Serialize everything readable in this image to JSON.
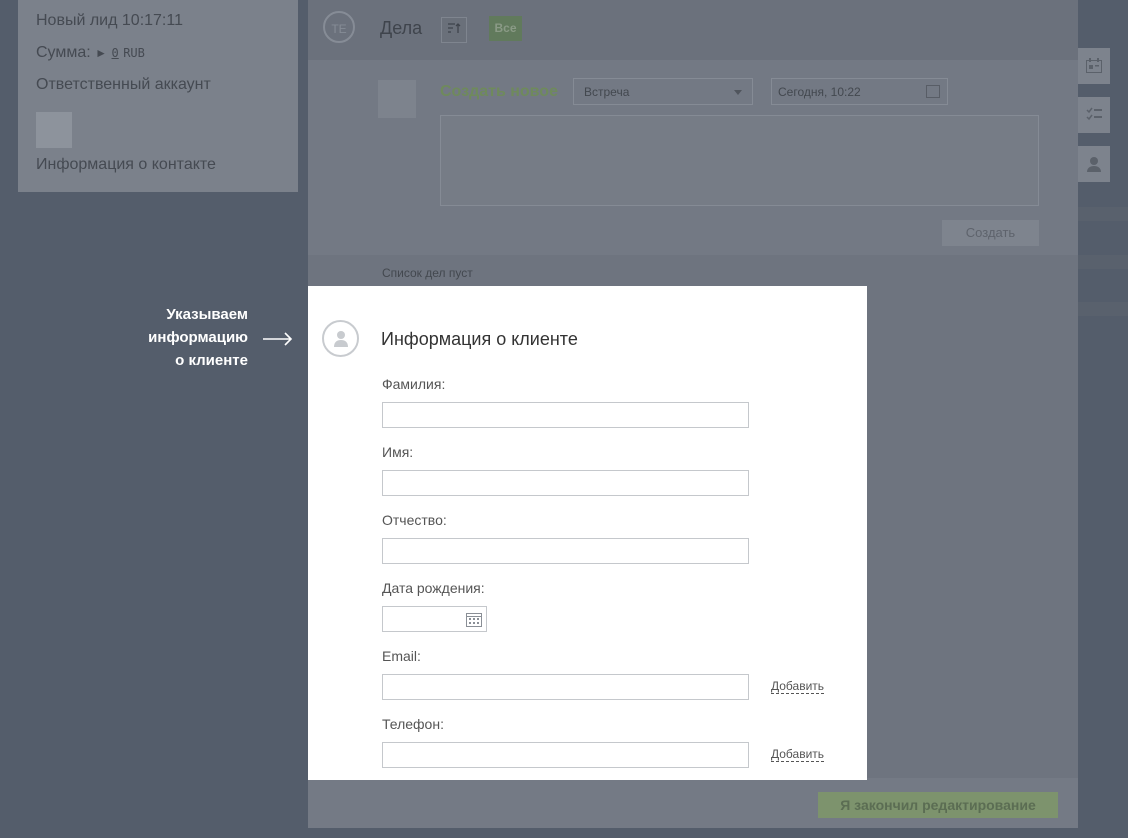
{
  "lead_card": {
    "title": "Новый лид 10:17:11",
    "sum_label": "Сумма:",
    "sum_value": "0",
    "currency": "RUB",
    "responsible": "Ответственный аккаунт",
    "contact_info": "Информация о контакте"
  },
  "deals": {
    "icon_text": "TE",
    "title": "Дела",
    "filter_all": "Все",
    "create_new": "Создать новое",
    "type_value": "Встреча",
    "date_value": "Сегодня, 10:22",
    "create_button": "Создать",
    "empty_list": "Список дел пуст"
  },
  "annotation": {
    "line1": "Указываем",
    "line2": "информацию",
    "line3": "о клиенте"
  },
  "client_form": {
    "title": "Информация о клиенте",
    "last_name_label": "Фамилия:",
    "first_name_label": "Имя:",
    "middle_name_label": "Отчество:",
    "birth_date_label": "Дата рождения:",
    "email_label": "Email:",
    "phone_label": "Телефон:",
    "add_label": "Добавить"
  },
  "footer": {
    "finish_button": "Я закончил редактирование"
  },
  "colors": {
    "overlay": "#545d6b",
    "accent_green": "#7d936d",
    "modal_bg": "#ffffff"
  }
}
